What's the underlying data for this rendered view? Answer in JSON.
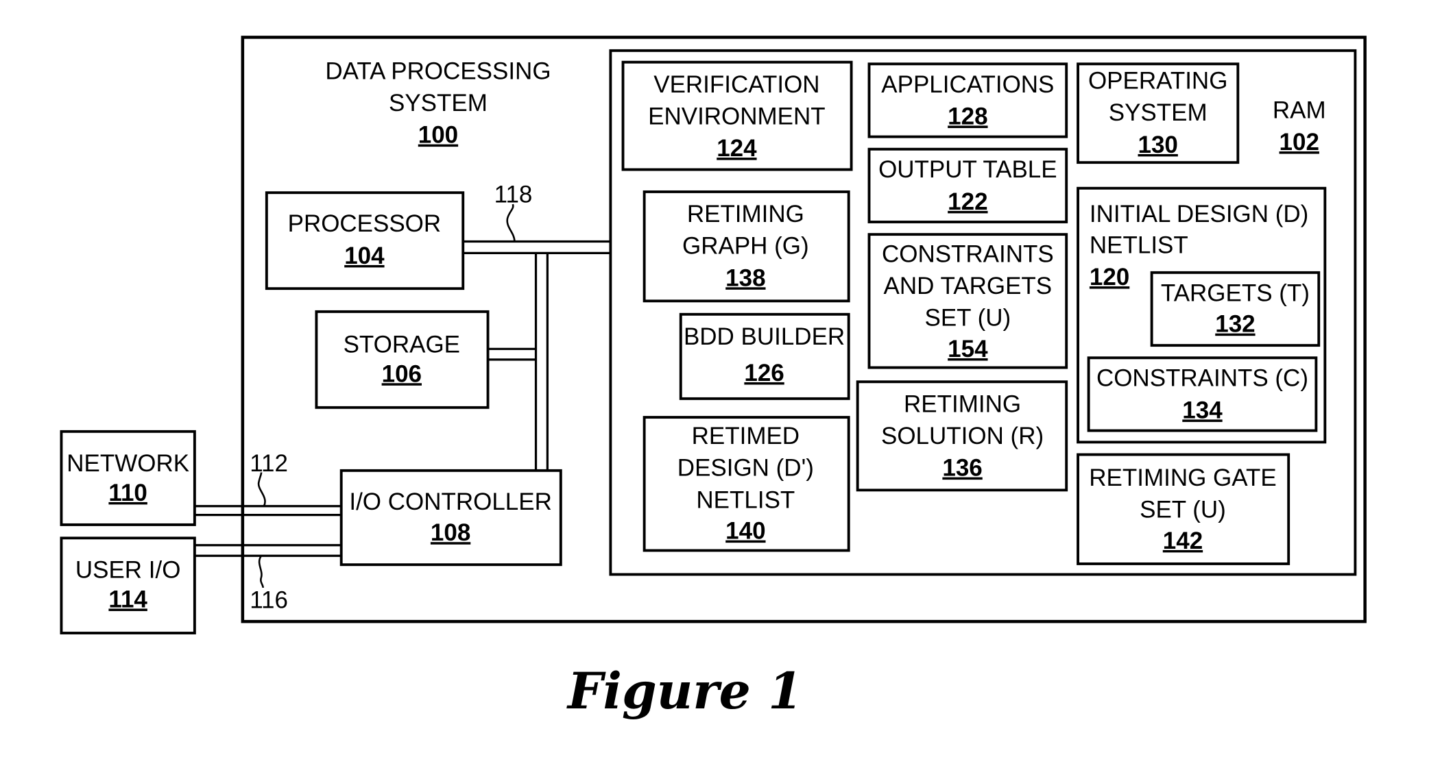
{
  "figure": {
    "caption": "Figure 1"
  },
  "system": {
    "lines": [
      "DATA PROCESSING",
      "SYSTEM"
    ],
    "ref": "100"
  },
  "ram": {
    "lines": [
      "RAM"
    ],
    "ref": "102"
  },
  "blocks": {
    "processor": {
      "lines": [
        "PROCESSOR"
      ],
      "ref": "104"
    },
    "storage": {
      "lines": [
        "STORAGE"
      ],
      "ref": "106"
    },
    "io_controller": {
      "lines": [
        "I/O CONTROLLER"
      ],
      "ref": "108"
    },
    "network": {
      "lines": [
        "NETWORK"
      ],
      "ref": "110"
    },
    "user_io": {
      "lines": [
        "USER I/O"
      ],
      "ref": "114"
    },
    "verification_environment": {
      "lines": [
        "VERIFICATION",
        "ENVIRONMENT"
      ],
      "ref": "124"
    },
    "applications": {
      "lines": [
        "APPLICATIONS"
      ],
      "ref": "128"
    },
    "operating_system": {
      "lines": [
        "OPERATING",
        "SYSTEM"
      ],
      "ref": "130"
    },
    "output_table": {
      "lines": [
        "OUTPUT TABLE"
      ],
      "ref": "122"
    },
    "retiming_graph": {
      "lines": [
        "RETIMING",
        "GRAPH (G)"
      ],
      "ref": "138"
    },
    "constraints_targets_set": {
      "lines": [
        "CONSTRAINTS",
        "AND TARGETS",
        "SET (U)"
      ],
      "ref": "154"
    },
    "initial_design_netlist": {
      "lines": [
        "INITIAL DESIGN (D)",
        "NETLIST"
      ],
      "ref": "120"
    },
    "targets": {
      "lines": [
        "TARGETS (T)"
      ],
      "ref": "132"
    },
    "bdd_builder": {
      "lines": [
        "BDD  BUILDER"
      ],
      "ref": "126"
    },
    "constraints": {
      "lines": [
        "CONSTRAINTS (C)"
      ],
      "ref": "134"
    },
    "retiming_solution": {
      "lines": [
        "RETIMING",
        "SOLUTION (R)"
      ],
      "ref": "136"
    },
    "retimed_design_netlist": {
      "lines": [
        "RETIMED",
        "DESIGN (D')",
        "NETLIST"
      ],
      "ref": "140"
    },
    "retiming_gate_set": {
      "lines": [
        "RETIMING GATE",
        "SET  (U)"
      ],
      "ref": "142"
    }
  },
  "connectors": {
    "bus": {
      "ref": "118"
    },
    "network_link": {
      "ref": "112"
    },
    "user_io_link": {
      "ref": "116"
    }
  }
}
